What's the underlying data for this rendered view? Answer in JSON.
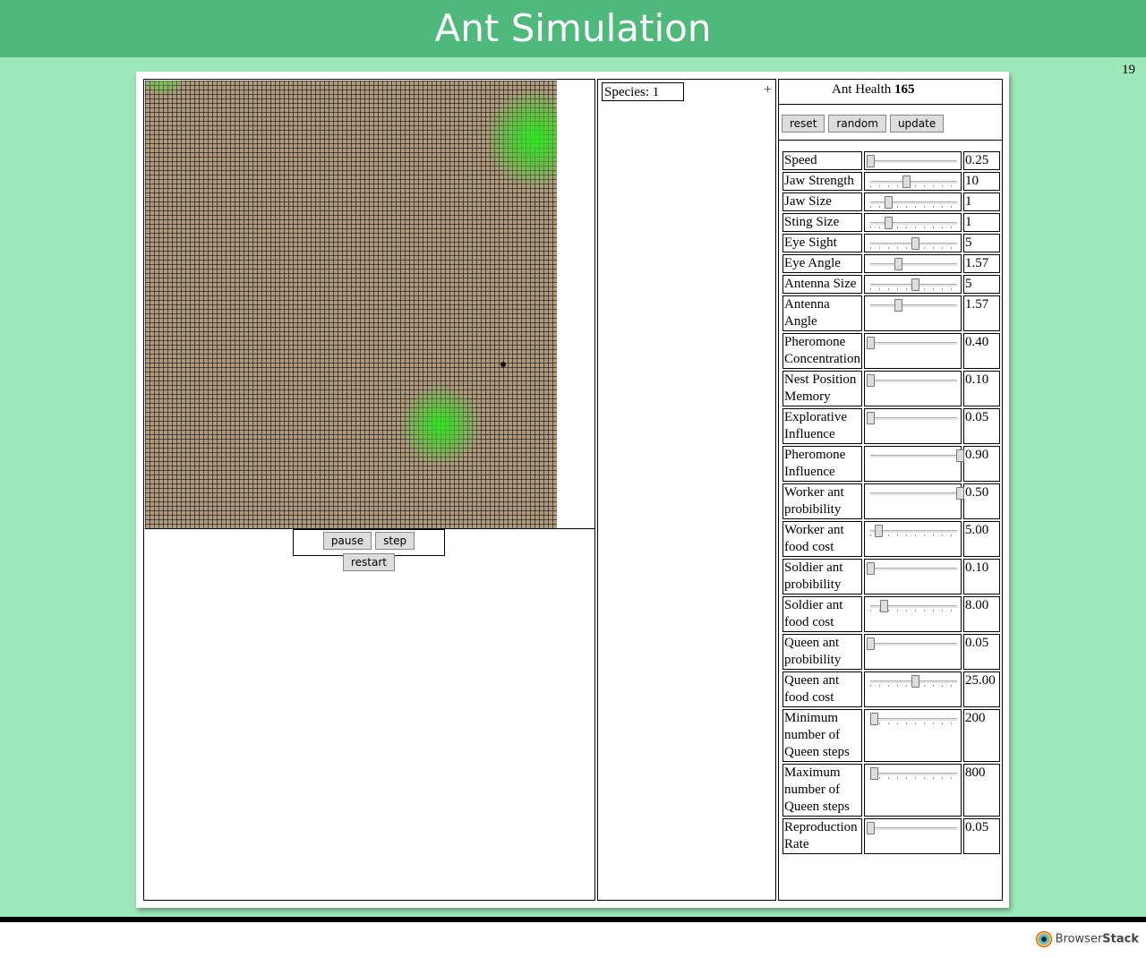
{
  "header": {
    "title": "Ant Simulation"
  },
  "page_number": "19",
  "simulation": {
    "controls": {
      "pause": "pause",
      "step": "step",
      "restart": "restart"
    }
  },
  "species": {
    "label": "Species: 1",
    "add": "+"
  },
  "parameters": {
    "health_label": "Ant Health",
    "health_value": "165",
    "buttons": {
      "reset": "reset",
      "random": "random",
      "update": "update"
    },
    "rows": [
      {
        "label": "Speed",
        "value": "0.25",
        "level": 0.0,
        "ticks": false
      },
      {
        "label": "Jaw Strength",
        "value": "10",
        "level": 0.4,
        "ticks": true
      },
      {
        "label": "Jaw Size",
        "value": "1",
        "level": 0.2,
        "ticks": true
      },
      {
        "label": "Sting Size",
        "value": "1",
        "level": 0.2,
        "ticks": true
      },
      {
        "label": "Eye Sight",
        "value": "5",
        "level": 0.5,
        "ticks": true
      },
      {
        "label": "Eye Angle",
        "value": "1.57",
        "level": 0.31,
        "ticks": false
      },
      {
        "label": "Antenna Size",
        "value": "5",
        "level": 0.5,
        "ticks": true
      },
      {
        "label": "Antenna Angle",
        "value": "1.57",
        "level": 0.31,
        "ticks": false
      },
      {
        "label": "Pheromone Concentration",
        "value": "0.40",
        "level": 0.0,
        "ticks": false
      },
      {
        "label": "Nest Position Memory",
        "value": "0.10",
        "level": 0.0,
        "ticks": false
      },
      {
        "label": "Explorative Influence",
        "value": "0.05",
        "level": 0.0,
        "ticks": false
      },
      {
        "label": "Pheromone Influence",
        "value": "0.90",
        "level": 1.0,
        "ticks": false
      },
      {
        "label": "Worker ant probibility",
        "value": "0.50",
        "level": 1.0,
        "ticks": false
      },
      {
        "label": "Worker ant food cost",
        "value": "5.00",
        "level": 0.09,
        "ticks": true
      },
      {
        "label": "Soldier ant probibility",
        "value": "0.10",
        "level": 0.0,
        "ticks": false
      },
      {
        "label": "Soldier ant food cost",
        "value": "8.00",
        "level": 0.15,
        "ticks": true
      },
      {
        "label": "Queen ant probibility",
        "value": "0.05",
        "level": 0.0,
        "ticks": false
      },
      {
        "label": "Queen ant food cost",
        "value": "25.00",
        "level": 0.5,
        "ticks": true
      },
      {
        "label": "Minimum number of Queen steps",
        "value": "200",
        "level": 0.04,
        "ticks": true
      },
      {
        "label": "Maximum number of Queen steps",
        "value": "800",
        "level": 0.04,
        "ticks": true
      },
      {
        "label": "Reproduction Rate",
        "value": "0.05",
        "level": 0.0,
        "ticks": false
      }
    ]
  },
  "footer": {
    "brand_light": "Browser",
    "brand_bold": "Stack"
  }
}
